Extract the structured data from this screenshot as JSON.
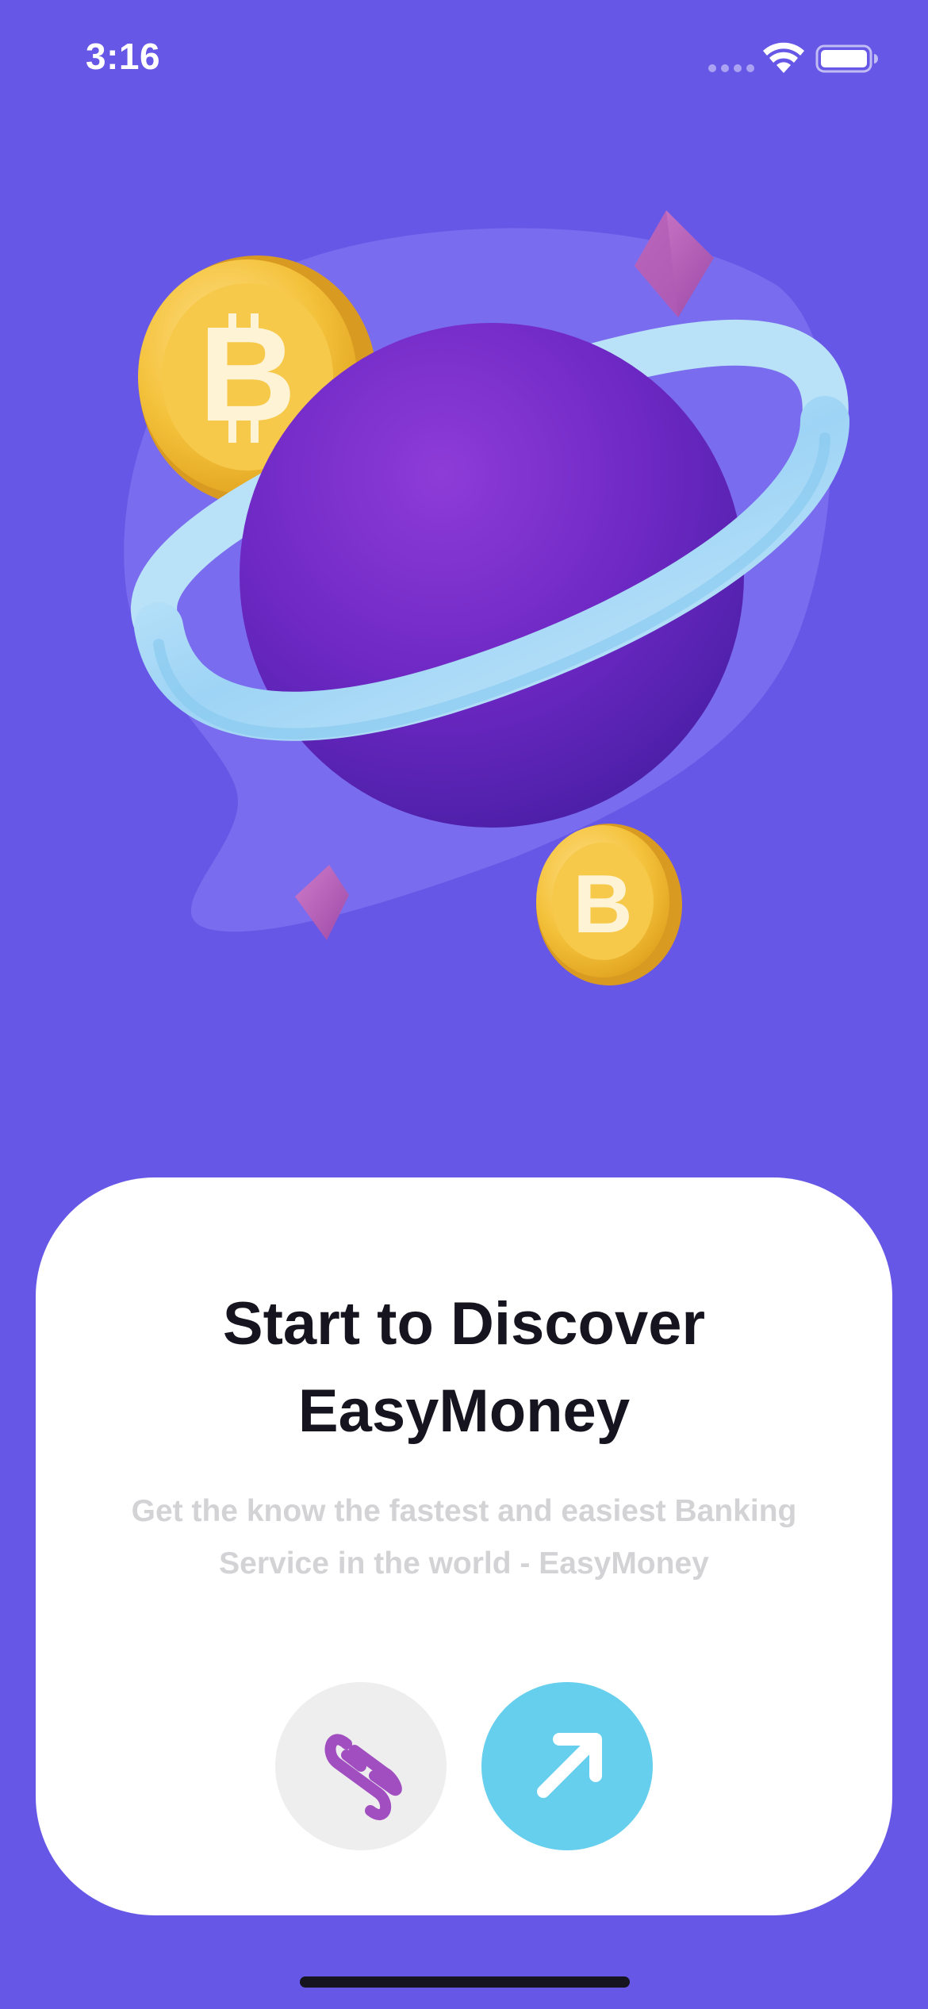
{
  "status_bar": {
    "time": "3:16",
    "icons": [
      "signal-dots-icon",
      "wifi-icon",
      "battery-icon"
    ]
  },
  "illustration": {
    "subject": "purple-ringed-planet-with-bitcoin-coins"
  },
  "onboarding": {
    "title_line1": "Start to Discover",
    "title_line2": "EasyMoney",
    "subtitle_line1": "Get the know the fastest and easiest Banking",
    "subtitle_line2": "Service in the world - EasyMoney",
    "link_button_icon": "infinity-link-icon",
    "next_button_icon": "arrow-up-right-icon"
  },
  "colors": {
    "background": "#6657E6",
    "card": "#FFFFFF",
    "title": "#16151F",
    "subtitle": "#D3D3D6",
    "next_button": "#66CFEE",
    "link_button": "#EEEEEF",
    "planet": "#7A2ED0",
    "ring": "#A9DCF7",
    "coin": "#F2C33E"
  }
}
